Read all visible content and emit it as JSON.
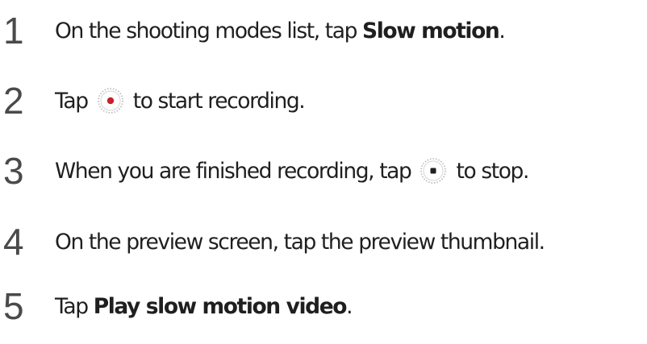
{
  "steps": [
    {
      "number": "1",
      "before": "On the shooting modes list, tap ",
      "bold": "Slow motion",
      "after": "."
    },
    {
      "number": "2",
      "before": "Tap ",
      "icon": "record-button-icon",
      "after": " to start recording."
    },
    {
      "number": "3",
      "before": "When you are finished recording, tap ",
      "icon": "stop-button-icon",
      "after": " to stop."
    },
    {
      "number": "4",
      "text": "On the preview screen, tap the preview thumbnail."
    },
    {
      "number": "5",
      "before": "Tap ",
      "bold": "Play slow motion video",
      "after": "."
    }
  ],
  "colors": {
    "record_dot": "#c8202a",
    "stop_square": "#1f1f1f",
    "icon_ring": "#b5b5b5"
  }
}
